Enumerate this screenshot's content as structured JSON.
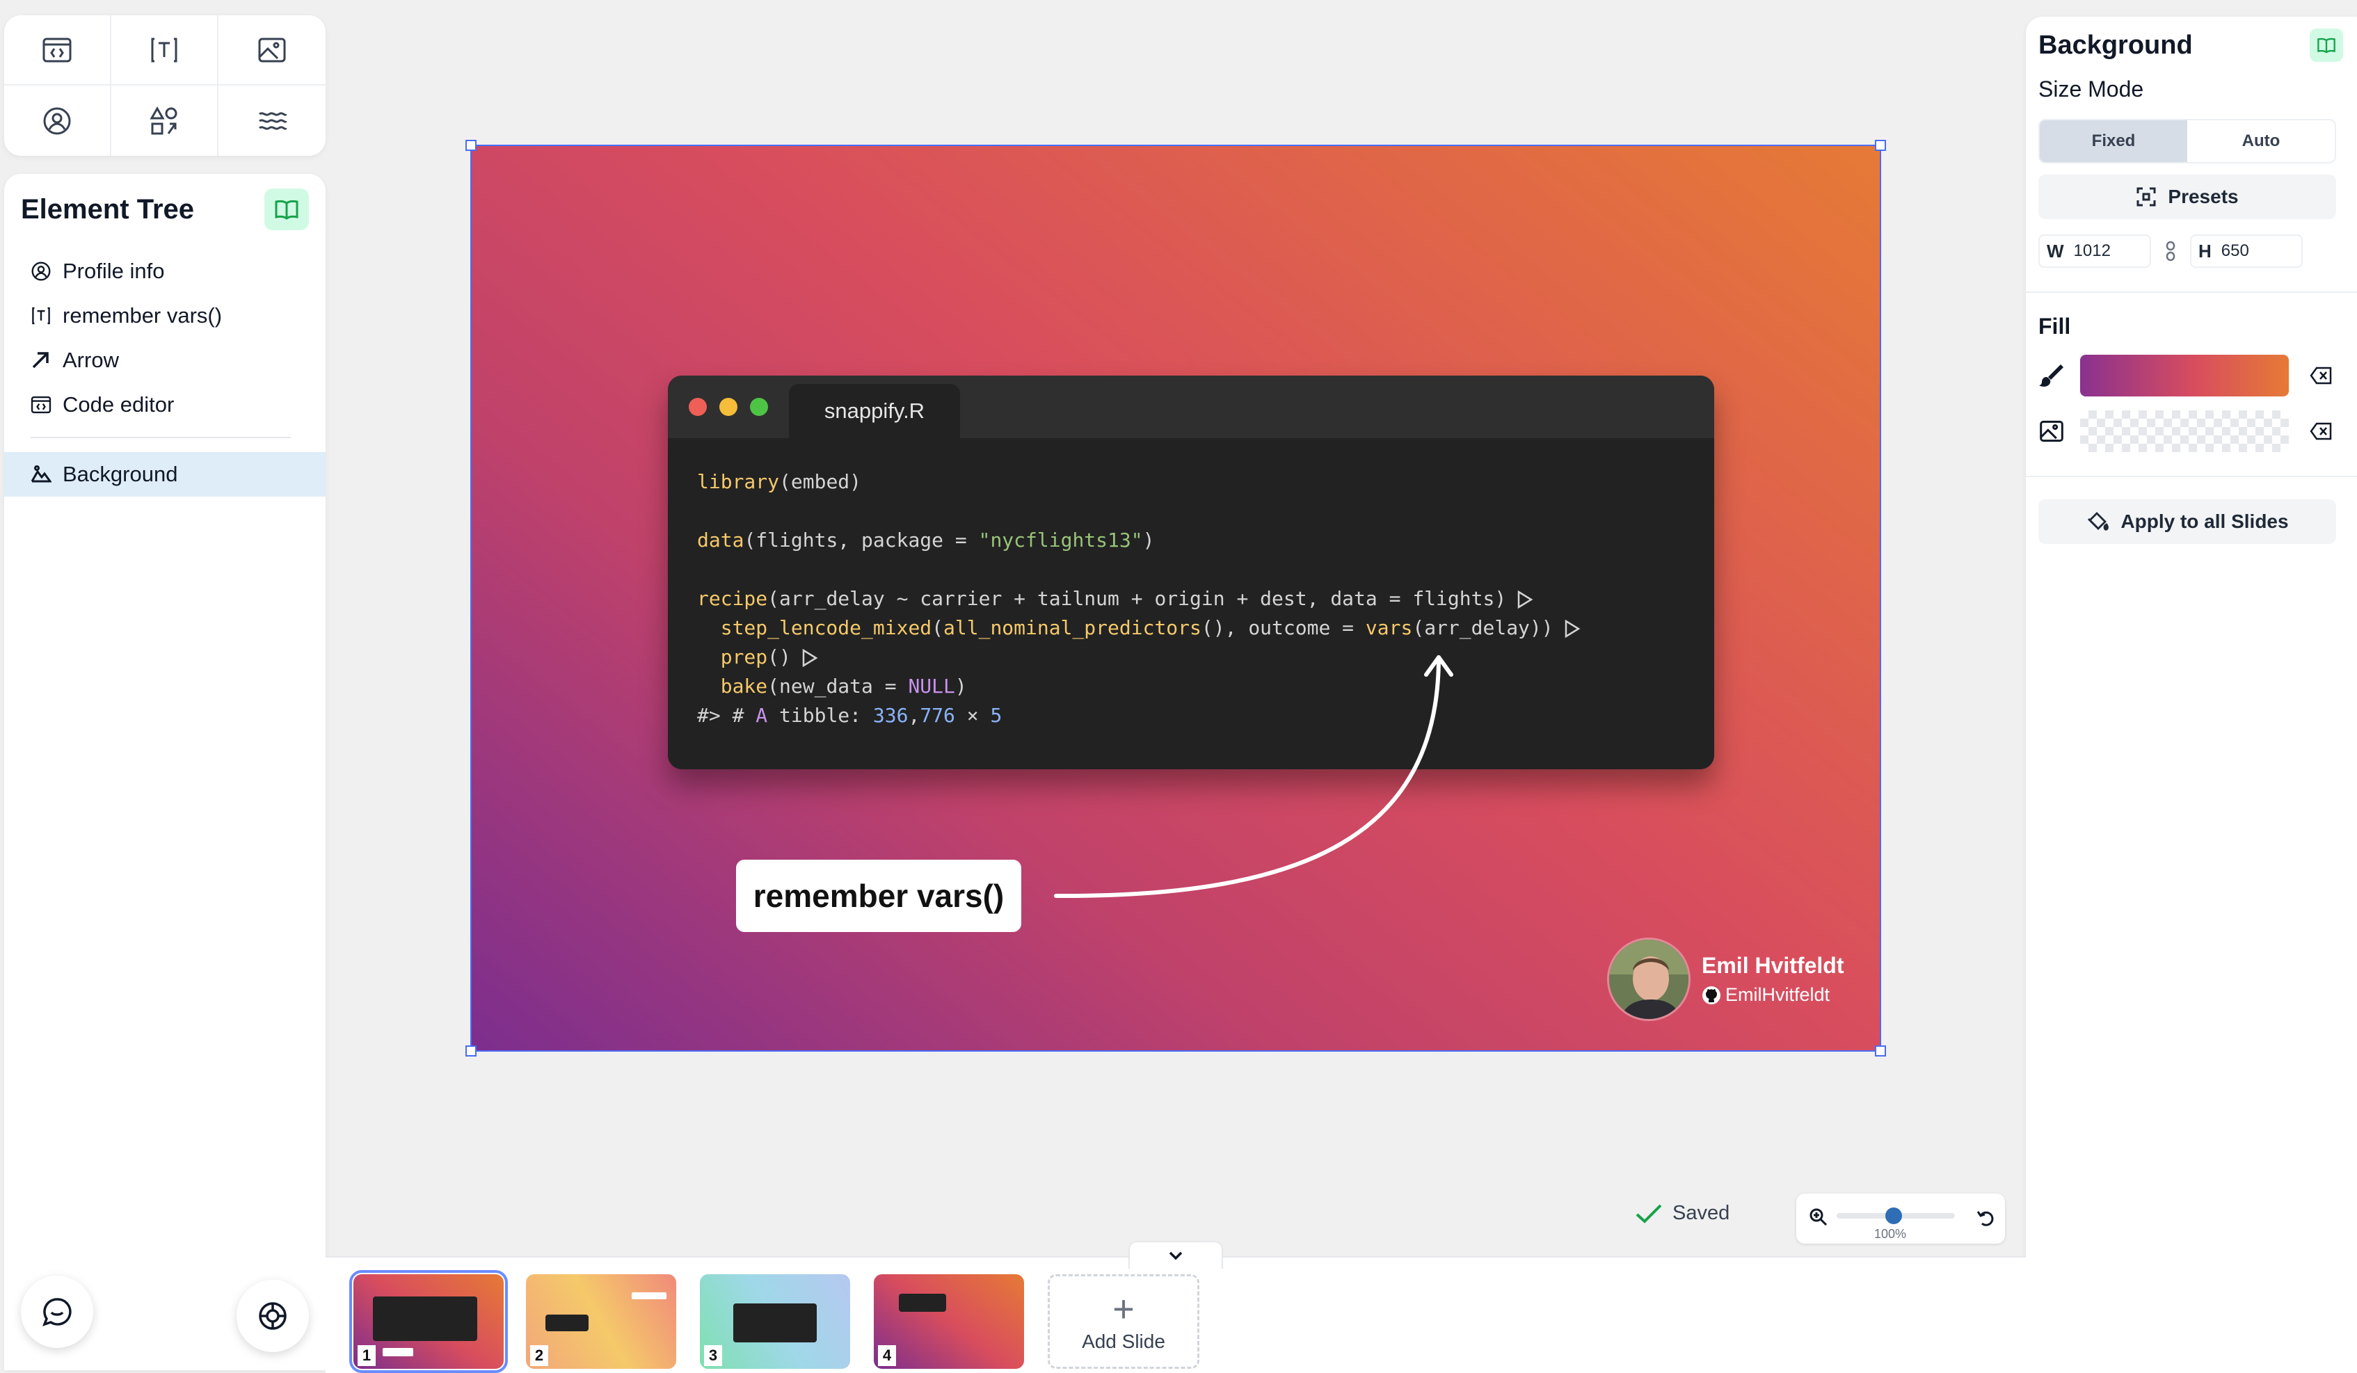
{
  "toolbar": {
    "tools": [
      "code-editor-tool",
      "text-tool",
      "image-tool",
      "profile-tool",
      "shapes-tool",
      "background-tool"
    ]
  },
  "element_tree": {
    "title": "Element Tree",
    "items": [
      {
        "label": "Profile info",
        "icon": "user-circle-icon"
      },
      {
        "label": "remember vars()",
        "icon": "text-icon"
      },
      {
        "label": "Arrow",
        "icon": "arrow-icon"
      },
      {
        "label": "Code editor",
        "icon": "code-icon"
      }
    ],
    "selected": {
      "label": "Background",
      "icon": "background-icon"
    }
  },
  "canvas": {
    "code_window": {
      "tab": "snappify.R",
      "dots": [
        "#ed5f57",
        "#f5bd3a",
        "#4fc346"
      ]
    },
    "callout": "remember vars()",
    "profile": {
      "name": "Emil Hvitfeldt",
      "handle": "EmilHvitfeldt"
    }
  },
  "props": {
    "title": "Background",
    "size_mode_label": "Size Mode",
    "size_modes": [
      "Fixed",
      "Auto"
    ],
    "selected_mode": "Fixed",
    "presets_label": "Presets",
    "width_label": "W",
    "width": "1012",
    "height_label": "H",
    "height": "650",
    "fill_label": "Fill",
    "apply_label": "Apply to all Slides"
  },
  "status": {
    "saved": "Saved",
    "zoom": "100%"
  },
  "slides": {
    "numbers": [
      "1",
      "2",
      "3",
      "4"
    ],
    "add_label": "Add Slide"
  },
  "colors": {
    "accent": "#4a6cf5",
    "gradient_start": "#7c2e8e",
    "gradient_mid": "#d84d5e",
    "gradient_end": "#e67a36"
  }
}
